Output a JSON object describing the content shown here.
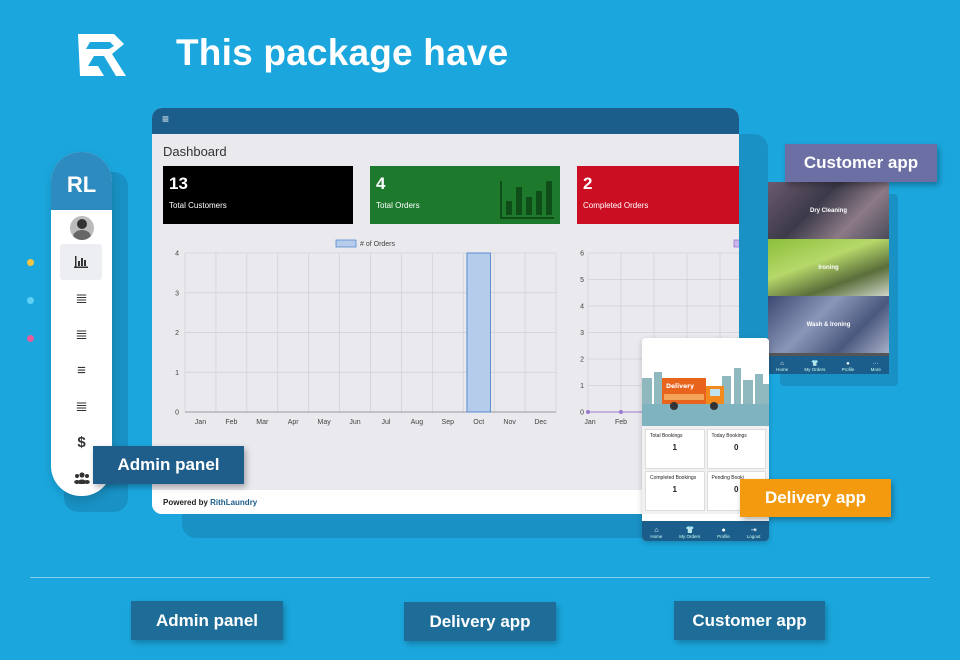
{
  "headline": "This package have",
  "sidebar": {
    "brand": "RL",
    "items": [
      {
        "icon": "bar-chart-icon",
        "glyph": "📊"
      },
      {
        "icon": "list-icon",
        "glyph": "≣"
      },
      {
        "icon": "list-icon",
        "glyph": "≣"
      },
      {
        "icon": "list-icon",
        "glyph": "≡"
      },
      {
        "icon": "list-icon",
        "glyph": "≣"
      },
      {
        "icon": "dollar-icon",
        "glyph": "$"
      },
      {
        "icon": "users-icon",
        "glyph": "👥"
      }
    ]
  },
  "dashboard": {
    "menu_glyph": "≡",
    "title": "Dashboard",
    "cards": [
      {
        "value": "13",
        "label": "Total Customers"
      },
      {
        "value": "4",
        "label": "Total Orders"
      },
      {
        "value": "2",
        "label": "Completed Orders"
      }
    ],
    "footer_prefix": "Powered by",
    "footer_brand": "RithLaundry"
  },
  "chart_data": [
    {
      "type": "bar",
      "legend": "# of Orders",
      "categories": [
        "Jan",
        "Feb",
        "Mar",
        "Apr",
        "May",
        "Jun",
        "Jul",
        "Aug",
        "Sep",
        "Oct",
        "Nov",
        "Dec"
      ],
      "values": [
        0,
        0,
        0,
        0,
        0,
        0,
        0,
        0,
        0,
        4,
        0,
        0
      ],
      "yticks": [
        0,
        1,
        2,
        3,
        4
      ],
      "ylim": [
        0,
        4
      ]
    },
    {
      "type": "line",
      "categories": [
        "Jan",
        "Feb"
      ],
      "values": [
        0,
        0
      ],
      "yticks": [
        0,
        1,
        2,
        3,
        4,
        5,
        6
      ],
      "ylim": [
        0,
        6
      ]
    }
  ],
  "customer_app": {
    "label": "Customer app",
    "bands": [
      "Dry Cleaning",
      "Ironing",
      "Wash & Ironing"
    ],
    "nav": [
      "Home",
      "My Orders",
      "Profile",
      "More"
    ]
  },
  "delivery_app": {
    "label": "Delivery app",
    "truck_text": "Delivery",
    "stats": [
      {
        "label": "Total Bookings",
        "value": "1"
      },
      {
        "label": "Today Bookings",
        "value": "0"
      },
      {
        "label": "Completed Bookings",
        "value": "1"
      },
      {
        "label": "Pending Booki",
        "value": "0"
      }
    ],
    "nav": [
      "Home",
      "My Orders",
      "Profile",
      "Logout"
    ]
  },
  "admin_label": "Admin panel",
  "buttons": {
    "admin": "Admin panel",
    "delivery": "Delivery app",
    "customer": "Customer app"
  },
  "colors": {
    "background": "#1ba7de",
    "topbar": "#1b5e8c",
    "orange": "#f39a0e",
    "purple": "#6c6fa4"
  }
}
